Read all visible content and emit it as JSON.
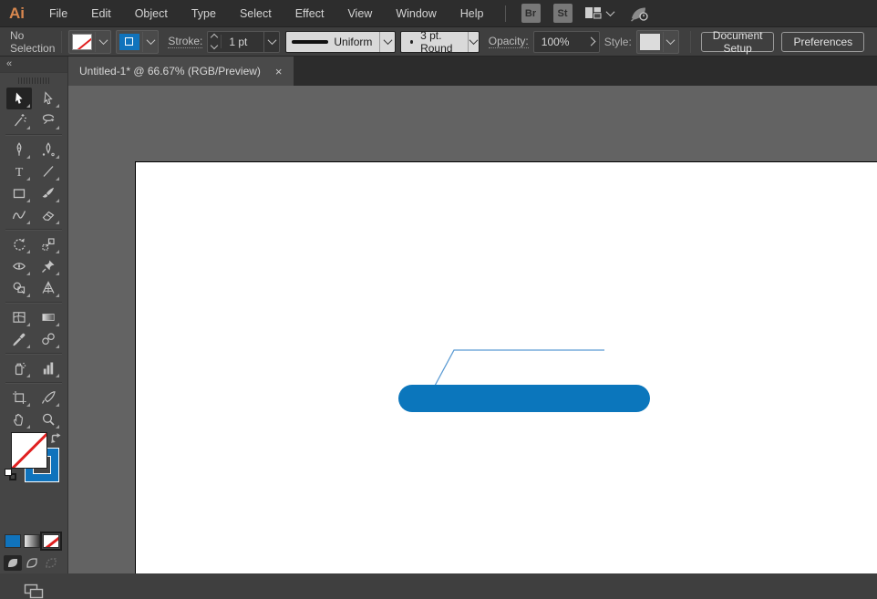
{
  "menubar": {
    "logo": "Ai",
    "items": [
      "File",
      "Edit",
      "Object",
      "Type",
      "Select",
      "Effect",
      "View",
      "Window",
      "Help"
    ],
    "bridge_label": "Br",
    "stock_label": "St",
    "icons": [
      "workspace-switcher-icon",
      "gpu-performance-icon"
    ]
  },
  "controlbar": {
    "status": "No Selection",
    "stroke_label": "Stroke:",
    "stroke_weight": "1 pt",
    "variable_width_profile": "Uniform",
    "brush_definition": "3 pt. Round",
    "opacity_label": "Opacity:",
    "opacity_value": "100%",
    "style_label": "Style:",
    "document_setup": "Document Setup",
    "preferences": "Preferences"
  },
  "tab": {
    "title": "Untitled-1* @ 66.67% (RGB/Preview)",
    "close": "×"
  },
  "toolbar": {
    "collapse_glyph": "◄◄",
    "selected_tool": "selection",
    "rows": [
      [
        "selection",
        "direct-selection"
      ],
      [
        "magic-wand",
        "lasso"
      ],
      "divider",
      [
        "pen",
        "curvature"
      ],
      [
        "type",
        "line-segment"
      ],
      [
        "rectangle",
        "paintbrush"
      ],
      [
        "shaper",
        "eraser"
      ],
      "divider",
      [
        "rotate",
        "scale"
      ],
      [
        "width",
        "puppet-warp"
      ],
      [
        "shape-builder",
        "perspective-grid"
      ],
      "divider",
      [
        "mesh",
        "gradient"
      ],
      [
        "eyedropper",
        "blend"
      ],
      "divider",
      [
        "symbol-sprayer",
        "column-graph"
      ],
      "divider",
      [
        "artboard-tool",
        "slice"
      ],
      [
        "hand",
        "zoom"
      ]
    ],
    "fill_value": "none",
    "stroke_value": "#1073bc",
    "color_type_buttons": [
      "color",
      "gradient",
      "none"
    ],
    "active_color_type": "none",
    "drawing_modes": [
      "draw-normal",
      "draw-behind",
      "draw-inside"
    ],
    "active_drawing_mode": "draw-normal"
  },
  "artwork": {
    "pill_fill": "#0b76bc",
    "line_stroke": "#5b9bd3"
  },
  "colors": {
    "accent_blue": "#1073bc",
    "ui_dark": "#2d2d2d",
    "ui_mid": "#3f3f3f",
    "ui_panel": "#454545",
    "canvas_gray": "#636363",
    "none_red": "#e02020"
  }
}
